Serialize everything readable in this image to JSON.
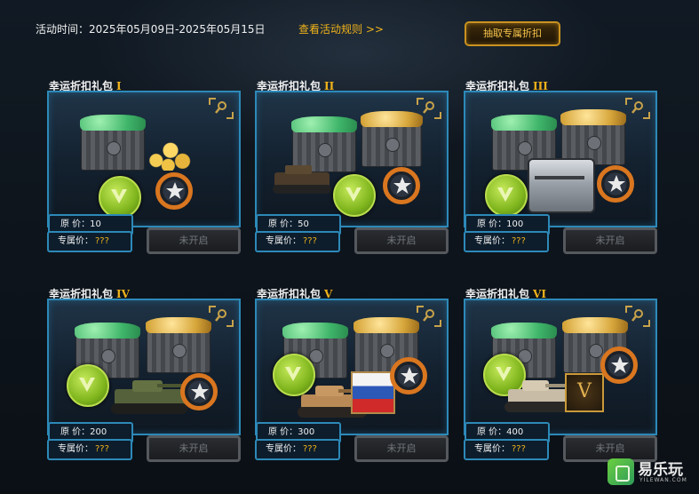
{
  "header": {
    "time_label": "活动时间：2025年05月09日-2025年05月15日",
    "rules_link": "查看活动规则 >>",
    "draw_button": "抽取专属折扣"
  },
  "packs": [
    {
      "title": "幸运折扣礼包",
      "numeral": "I",
      "original_price": "原   价：10",
      "exclusive_label": "专属价：",
      "exclusive_value": "???",
      "status_button": "未开启"
    },
    {
      "title": "幸运折扣礼包",
      "numeral": "II",
      "original_price": "原   价：50",
      "exclusive_label": "专属价：",
      "exclusive_value": "???",
      "status_button": "未开启"
    },
    {
      "title": "幸运折扣礼包",
      "numeral": "III",
      "original_price": "原   价：100",
      "exclusive_label": "专属价：",
      "exclusive_value": "???",
      "status_button": "未开启"
    },
    {
      "title": "幸运折扣礼包",
      "numeral": "IV",
      "original_price": "原   价：200",
      "exclusive_label": "专属价：",
      "exclusive_value": "???",
      "status_button": "未开启"
    },
    {
      "title": "幸运折扣礼包",
      "numeral": "V",
      "original_price": "原   价：300",
      "exclusive_label": "专属价：",
      "exclusive_value": "???",
      "status_button": "未开启"
    },
    {
      "title": "幸运折扣礼包",
      "numeral": "VI",
      "original_price": "原   价：400",
      "exclusive_label": "专属价：",
      "exclusive_value": "???",
      "status_button": "未开启",
      "badge_text": "V"
    }
  ],
  "watermark": {
    "name": "易乐玩",
    "sub": "YILEWAN.COM"
  },
  "colors": {
    "accent_gold": "#f0b21a",
    "frame_blue": "#2d89b8",
    "disabled_gray": "#74787d"
  }
}
